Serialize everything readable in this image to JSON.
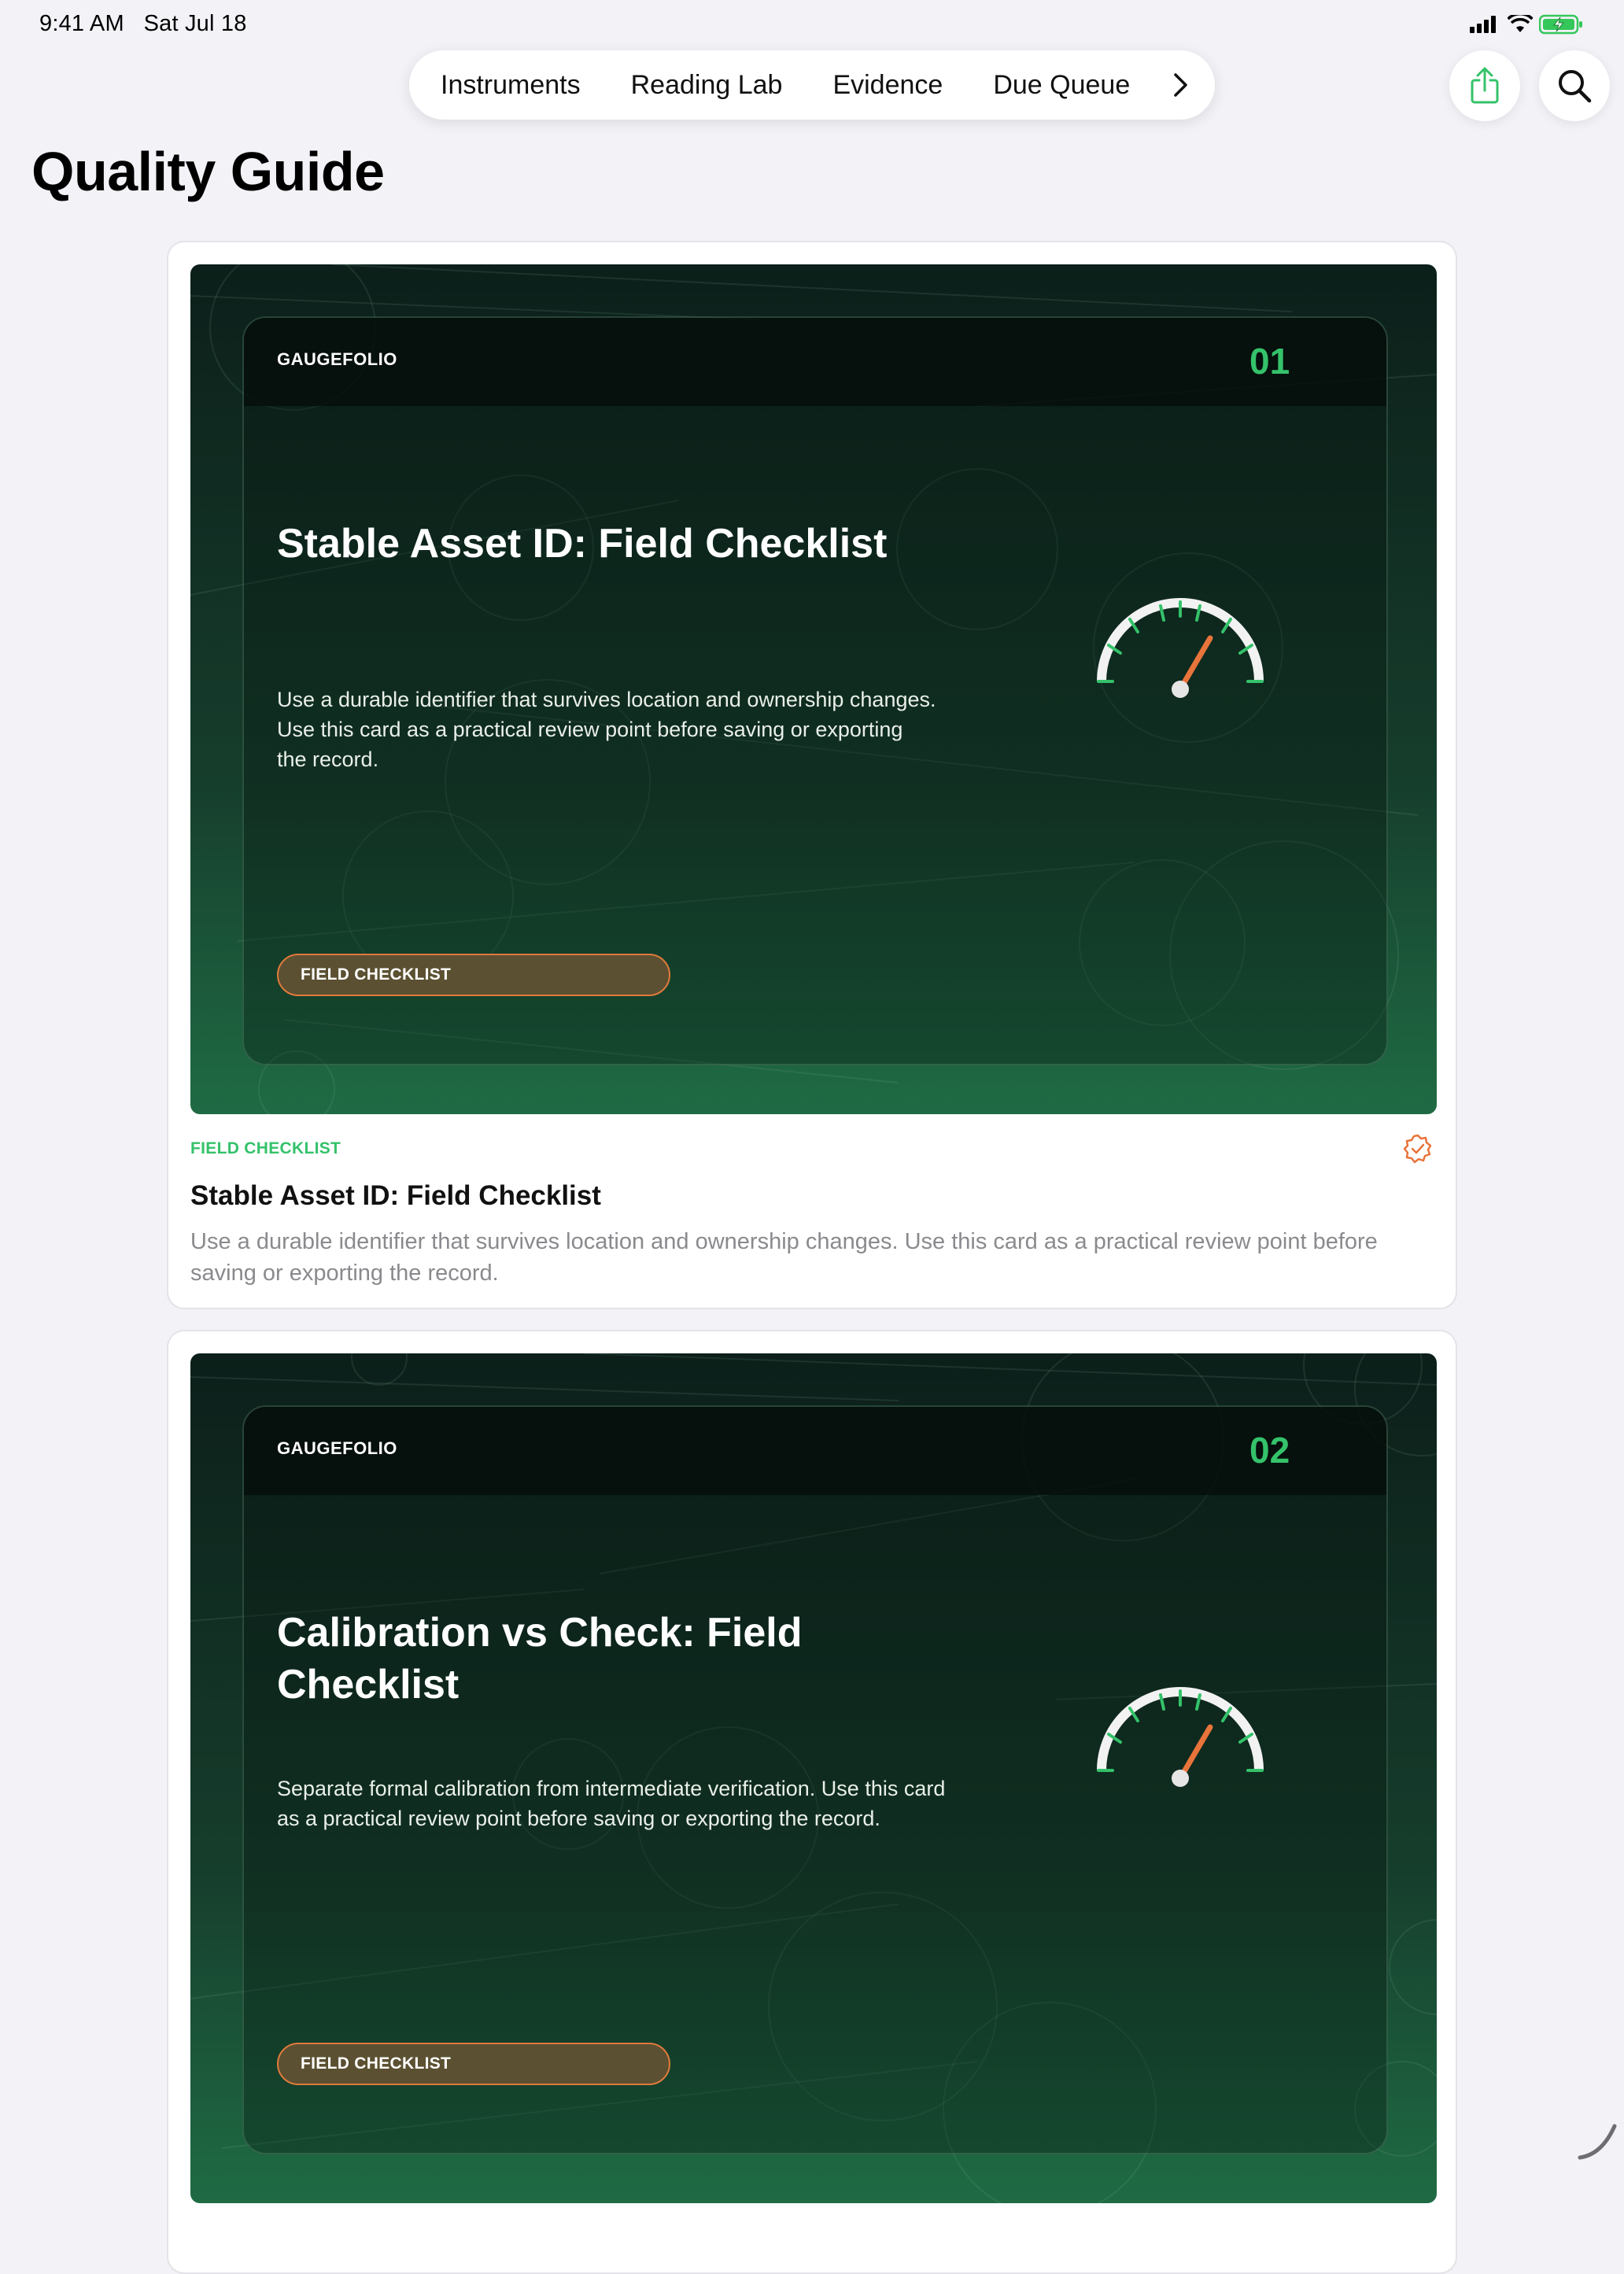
{
  "status": {
    "time": "9:41 AM",
    "date": "Sat Jul 18"
  },
  "nav": {
    "tabs": [
      "Instruments",
      "Reading Lab",
      "Evidence",
      "Due Queue"
    ],
    "more_icon": "chevron-right-icon",
    "share_icon": "share-icon",
    "search_icon": "search-icon"
  },
  "page": {
    "title": "Quality Guide"
  },
  "colors": {
    "accent": "#34c26a",
    "orange": "#e8743b",
    "bg": "#f2f2f7"
  },
  "cards": [
    {
      "brand": "GAUGEFOLIO",
      "number": "01",
      "hero_title": "Stable Asset ID: Field Checklist",
      "hero_desc": "Use a durable identifier that survives location and ownership changes. Use this card as a practical review point before saving or exporting the record.",
      "pill": "FIELD CHECKLIST",
      "category": "FIELD CHECKLIST",
      "title": "Stable Asset ID: Field Checklist",
      "desc": "Use a durable identifier that survives location and ownership changes. Use this card as a practical review point before saving or exporting the record."
    },
    {
      "brand": "GAUGEFOLIO",
      "number": "02",
      "hero_title": "Calibration vs Check: Field Checklist",
      "hero_desc": "Separate formal calibration from intermediate verification. Use this card as a practical review point before saving or exporting the record.",
      "pill": "FIELD CHECKLIST",
      "category": "FIELD CHECKLIST",
      "title": "Calibration vs Check: Field Checklist",
      "desc": "Separate formal calibration from intermediate verification. Use this card as a practical review point before saving or exporting the record."
    }
  ]
}
